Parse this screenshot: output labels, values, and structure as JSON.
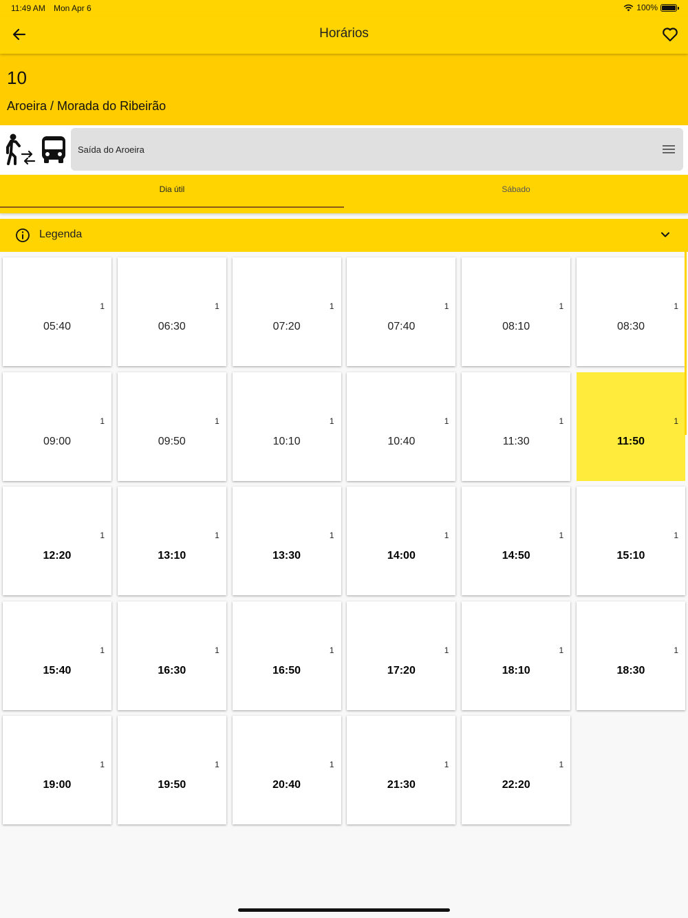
{
  "status": {
    "time": "11:49 AM",
    "date": "Mon Apr 6",
    "battery": "100%"
  },
  "appbar": {
    "title": "Horários"
  },
  "route": {
    "number": "10",
    "name": "Aroeira / Morada do Ribeirão"
  },
  "direction": {
    "selected": "Saída do Aroeira"
  },
  "tabs": [
    {
      "label": "Dia útil"
    },
    {
      "label": "Sábado"
    }
  ],
  "legend": {
    "label": "Legenda"
  },
  "schedule": [
    {
      "time": "05:40",
      "badge": "1"
    },
    {
      "time": "06:30",
      "badge": "1"
    },
    {
      "time": "07:20",
      "badge": "1"
    },
    {
      "time": "07:40",
      "badge": "1"
    },
    {
      "time": "08:10",
      "badge": "1"
    },
    {
      "time": "08:30",
      "badge": "1"
    },
    {
      "time": "09:00",
      "badge": "1"
    },
    {
      "time": "09:50",
      "badge": "1"
    },
    {
      "time": "10:10",
      "badge": "1"
    },
    {
      "time": "10:40",
      "badge": "1"
    },
    {
      "time": "11:30",
      "badge": "1"
    },
    {
      "time": "11:50",
      "badge": "1"
    },
    {
      "time": "12:20",
      "badge": "1"
    },
    {
      "time": "13:10",
      "badge": "1"
    },
    {
      "time": "13:30",
      "badge": "1"
    },
    {
      "time": "14:00",
      "badge": "1"
    },
    {
      "time": "14:50",
      "badge": "1"
    },
    {
      "time": "15:10",
      "badge": "1"
    },
    {
      "time": "15:40",
      "badge": "1"
    },
    {
      "time": "16:30",
      "badge": "1"
    },
    {
      "time": "16:50",
      "badge": "1"
    },
    {
      "time": "17:20",
      "badge": "1"
    },
    {
      "time": "18:10",
      "badge": "1"
    },
    {
      "time": "18:30",
      "badge": "1"
    },
    {
      "time": "19:00",
      "badge": "1"
    },
    {
      "time": "19:50",
      "badge": "1"
    },
    {
      "time": "20:40",
      "badge": "1"
    },
    {
      "time": "21:30",
      "badge": "1"
    },
    {
      "time": "22:20",
      "badge": "1"
    }
  ],
  "current_departure_index": 11,
  "colors": {
    "brand_yellow": "#ffd400",
    "header_yellow": "#ffcc00",
    "highlight": "#ffeb3b",
    "tab_indicator": "#8a5a16"
  },
  "icons": [
    "arrow-back-icon",
    "heart-outline-icon",
    "walk-transfer-icon",
    "bus-icon",
    "menu-icon",
    "info-icon",
    "chevron-down-icon",
    "wifi-icon",
    "battery-icon"
  ]
}
